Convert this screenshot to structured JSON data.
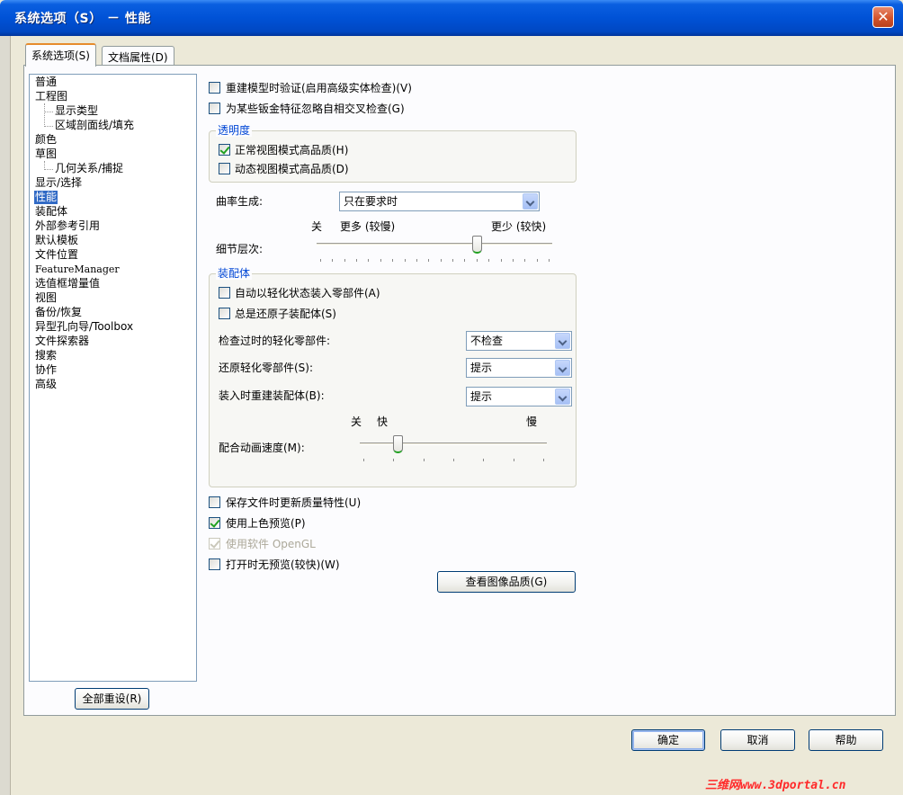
{
  "window": {
    "title": "系统选项（S） － 性能",
    "close_glyph": "✕"
  },
  "tabs": [
    {
      "label": "系统选项(S)",
      "active": true
    },
    {
      "label": "文档属性(D)",
      "active": false
    }
  ],
  "tree": {
    "items": [
      {
        "label": "普通",
        "level": 0
      },
      {
        "label": "工程图",
        "level": 0
      },
      {
        "label": "显示类型",
        "level": 1
      },
      {
        "label": "区域剖面线/填充",
        "level": 1
      },
      {
        "label": "颜色",
        "level": 0
      },
      {
        "label": "草图",
        "level": 0
      },
      {
        "label": "几何关系/捕捉",
        "level": 1
      },
      {
        "label": "显示/选择",
        "level": 0
      },
      {
        "label": "性能",
        "level": 0,
        "selected": true
      },
      {
        "label": "装配体",
        "level": 0
      },
      {
        "label": "外部参考引用",
        "level": 0
      },
      {
        "label": "默认模板",
        "level": 0
      },
      {
        "label": "文件位置",
        "level": 0
      },
      {
        "label": "FeatureManager",
        "level": 0
      },
      {
        "label": "选值框增量值",
        "level": 0
      },
      {
        "label": "视图",
        "level": 0
      },
      {
        "label": "备份/恢复",
        "level": 0
      },
      {
        "label": "异型孔向导/Toolbox",
        "level": 0
      },
      {
        "label": "文件探索器",
        "level": 0
      },
      {
        "label": "搜索",
        "level": 0
      },
      {
        "label": "协作",
        "level": 0
      },
      {
        "label": "高级",
        "level": 0
      }
    ],
    "reset_button": "全部重设(R)"
  },
  "options": {
    "rebuild_verify": {
      "label": "重建模型时验证(启用高级实体检查)(V)",
      "checked": false
    },
    "ignore_sheetmetal": {
      "label": "为某些钣金特征忽略自相交叉检查(G)",
      "checked": false
    }
  },
  "transparency": {
    "title": "透明度",
    "normal_hq": {
      "label": "正常视图模式高品质(H)",
      "checked": true
    },
    "dynamic_hq": {
      "label": "动态视图模式高品质(D)",
      "checked": false
    }
  },
  "curvature": {
    "label": "曲率生成:",
    "value": "只在要求时"
  },
  "detail_level": {
    "label": "细节层次:",
    "off_label": "关",
    "more_label": "更多 (较慢)",
    "less_label": "更少 (较快)",
    "position_fraction": 0.69
  },
  "assemblies": {
    "title": "装配体",
    "auto_lightweight": {
      "label": "自动以轻化状态装入零部件(A)",
      "checked": false
    },
    "always_resolve": {
      "label": "总是还原子装配体(S)",
      "checked": false
    },
    "check_outdated": {
      "label": "检查过时的轻化零部件:",
      "value": "不检查"
    },
    "resolve_lightweight": {
      "label": "还原轻化零部件(S):",
      "value": "提示"
    },
    "rebuild_on_load": {
      "label": "装入时重建装配体(B):",
      "value": "提示"
    },
    "animation": {
      "label": "配合动画速度(M):",
      "off_label": "关",
      "fast_label": "快",
      "slow_label": "慢",
      "position_fraction": 0.19
    }
  },
  "bottom_options": {
    "update_mass": {
      "label": "保存文件时更新质量特性(U)",
      "checked": false
    },
    "shaded_preview": {
      "label": "使用上色预览(P)",
      "checked": true
    },
    "software_opengl": {
      "label": "使用软件 OpenGL",
      "checked": true,
      "disabled": true
    },
    "no_preview": {
      "label": "打开时无预览(较快)(W)",
      "checked": false
    }
  },
  "view_image_quality": "查看图像品质(G)",
  "dialog_buttons": {
    "ok": "确定",
    "cancel": "取消",
    "help": "帮助"
  },
  "watermark": "三维网www.3dportal.cn"
}
